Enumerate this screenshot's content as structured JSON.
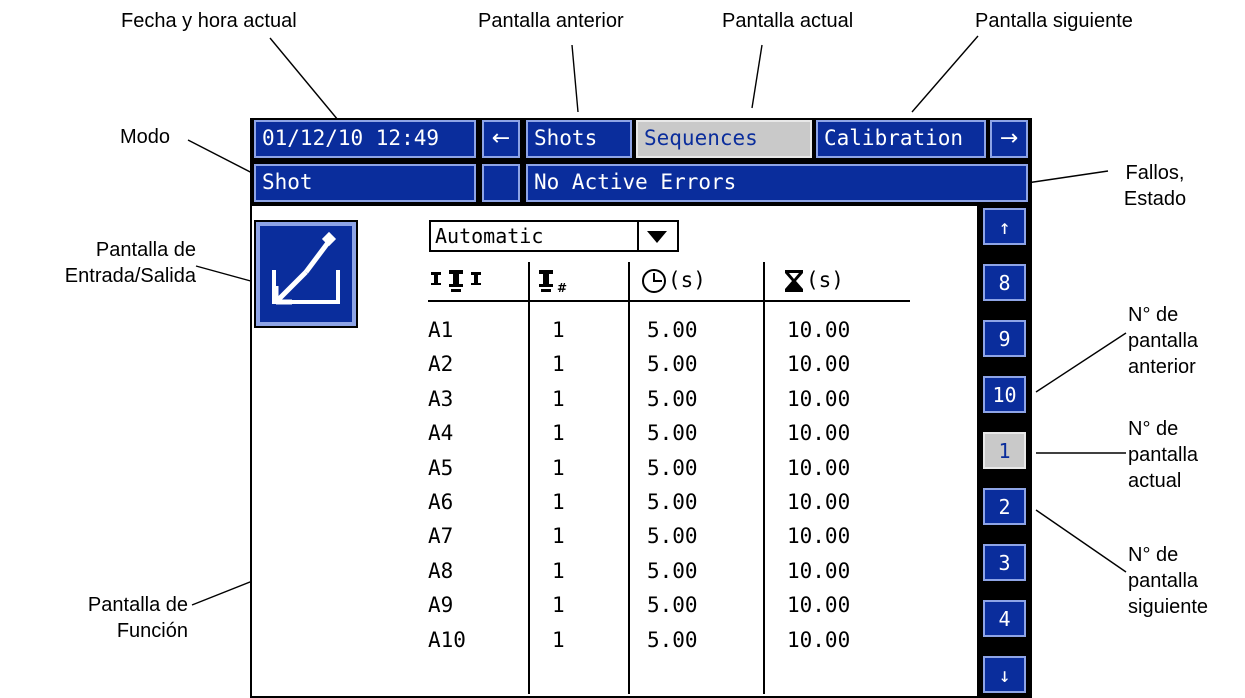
{
  "callouts": {
    "fecha": "Fecha y hora actual",
    "anterior": "Pantalla anterior",
    "actual": "Pantalla actual",
    "siguiente": "Pantalla siguiente",
    "modo": "Modo",
    "fallos_1": "Fallos,",
    "fallos_2": "Estado",
    "entrada_1": "Pantalla de",
    "entrada_2": "Entrada/Salida",
    "num_ant_1": "N° de",
    "num_ant_2": "pantalla",
    "num_ant_3": "anterior",
    "num_act_1": "N° de",
    "num_act_2": "pantalla",
    "num_act_3": "actual",
    "num_sig_1": "N° de",
    "num_sig_2": "pantalla",
    "num_sig_3": "siguiente",
    "funcion_1": "Pantalla de",
    "funcion_2": "Función"
  },
  "topbar": {
    "datetime": "01/12/10 12:49",
    "prev_arrow": "←",
    "tab_prev": "Shots",
    "tab_current": "Sequences",
    "tab_next": "Calibration",
    "next_arrow": "→"
  },
  "statusbar": {
    "mode": "Shot",
    "status_icon": "",
    "message": "No Active Errors"
  },
  "dropdown": {
    "value": "Automatic",
    "icon": "chevron-down-icon"
  },
  "table": {
    "headers": [
      "",
      "",
      "(s)",
      "(s)"
    ],
    "header_icons": [
      "dispense-valves-icon",
      "valve-number-icon",
      "clock-icon",
      "hourglass-icon"
    ],
    "rows": [
      [
        "A1",
        "1",
        "5.00",
        "10.00"
      ],
      [
        "A2",
        "1",
        "5.00",
        "10.00"
      ],
      [
        "A3",
        "1",
        "5.00",
        "10.00"
      ],
      [
        "A4",
        "1",
        "5.00",
        "10.00"
      ],
      [
        "A5",
        "1",
        "5.00",
        "10.00"
      ],
      [
        "A6",
        "1",
        "5.00",
        "10.00"
      ],
      [
        "A7",
        "1",
        "5.00",
        "10.00"
      ],
      [
        "A8",
        "1",
        "5.00",
        "10.00"
      ],
      [
        "A9",
        "1",
        "5.00",
        "10.00"
      ],
      [
        "A10",
        "1",
        "5.00",
        "10.00"
      ]
    ]
  },
  "sidebar": {
    "up": "↑",
    "pages": [
      "8",
      "9",
      "10",
      "1",
      "2",
      "3",
      "4"
    ],
    "current_page": "1",
    "down": "↓"
  },
  "colors": {
    "panel_blue": "#0a2d9c",
    "selected_gray": "#c9c9c9",
    "border_light": "#8ea4e6"
  }
}
